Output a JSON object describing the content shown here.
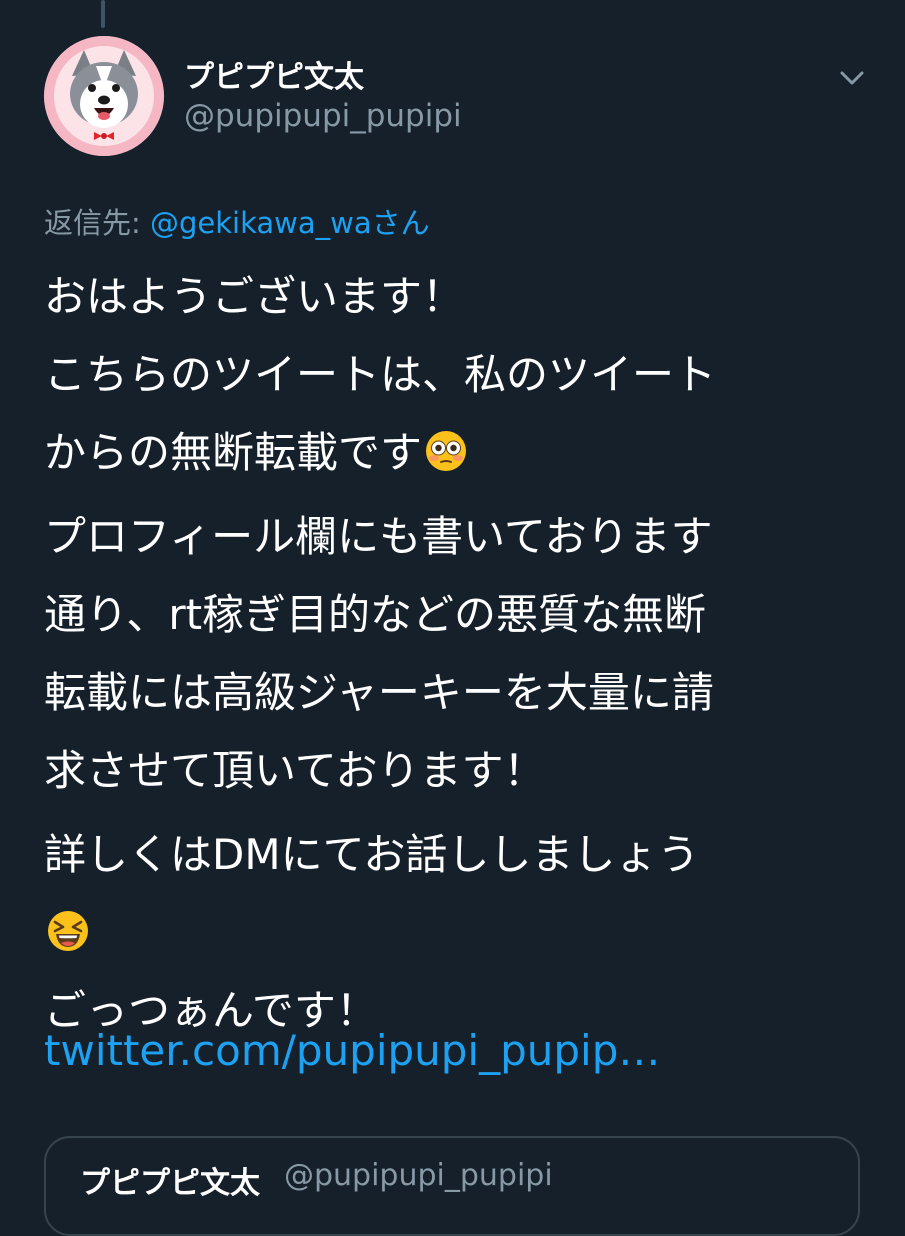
{
  "colors": {
    "background": "#15202b",
    "text": "#ffffff",
    "secondary_text": "#8899a6",
    "link": "#1da1f2",
    "border": "#38444d"
  },
  "tweet": {
    "author": {
      "display_name": "プピプピ文太",
      "handle": "@pupipupi_pupipi"
    },
    "menu_icon": "chevron-down-icon",
    "reply_to": {
      "prefix": "返信先: ",
      "mention": "@gekikawa_wa",
      "suffix": "さん"
    },
    "body": {
      "p1_text": "おはようございます！\nこちらのツイートは、私のツイート\nからの無断転載です",
      "p1_emoji": "flushed-face-emoji",
      "p2_text": "プロフィール欄にも書いております\n通り、rt稼ぎ目的などの悪質な無断\n転載には高級ジャーキーを大量に請\n求させて頂いております！",
      "p3_line1": "詳しくはDMにてお話ししましょう",
      "p3_emoji": "grinning-squinting-face-emoji",
      "p3_line3": "ごっつぁんです！"
    },
    "link": "twitter.com/pupipupi_pupip…"
  },
  "quoted_tweet": {
    "display_name": "プピプピ文太",
    "handle": "@pupipupi_pupipi"
  }
}
